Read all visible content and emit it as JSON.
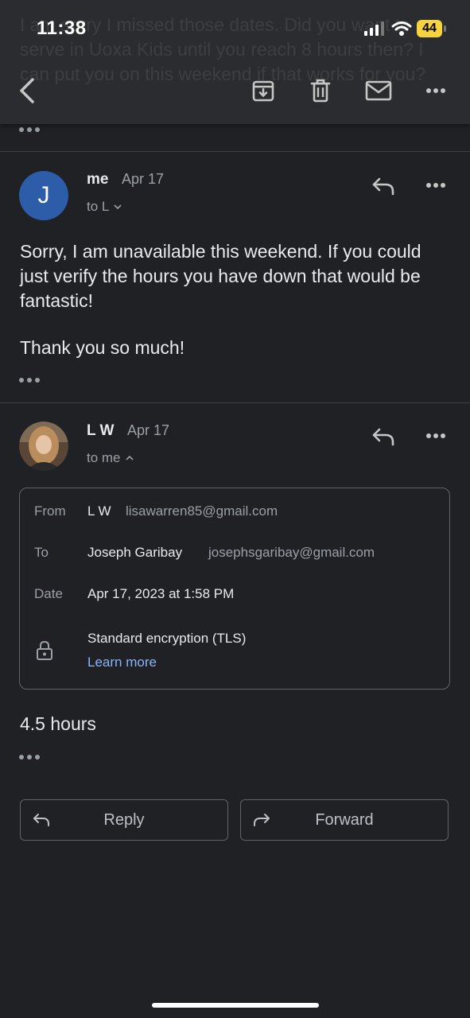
{
  "status_bar": {
    "time": "11:38",
    "battery": "44"
  },
  "previous_message": {
    "preview": "I am sorry I missed those dates. Did you want to serve in Uoxa Kids until you reach 8 hours then? I can put you on this weekend if that works for you?"
  },
  "messages": [
    {
      "avatar_letter": "J",
      "sender": "me",
      "date": "Apr 17",
      "recipients": "to L",
      "body": [
        "Sorry, I am unavailable this weekend. If you could just verify the hours you have down that would be fantastic!",
        "Thank you so much!"
      ]
    },
    {
      "sender": "L W",
      "date": "Apr 17",
      "recipients": "to me",
      "details": {
        "from_label": "From",
        "from_name": "L W",
        "from_email": "lisawarren85@gmail.com",
        "to_label": "To",
        "to_name": "Joseph Garibay",
        "to_email": "josephsgaribay@gmail.com",
        "date_label": "Date",
        "date_value": "Apr 17, 2023 at 1:58 PM",
        "encryption": "Standard encryption (TLS)",
        "learn_more": "Learn more"
      },
      "body": "4.5 hours"
    }
  ],
  "actions": {
    "reply": "Reply",
    "forward": "Forward"
  },
  "colors": {
    "background": "#202124",
    "accent_link": "#8ab4f8",
    "avatar_j": "#2d5da8",
    "battery": "#f7d33d"
  }
}
